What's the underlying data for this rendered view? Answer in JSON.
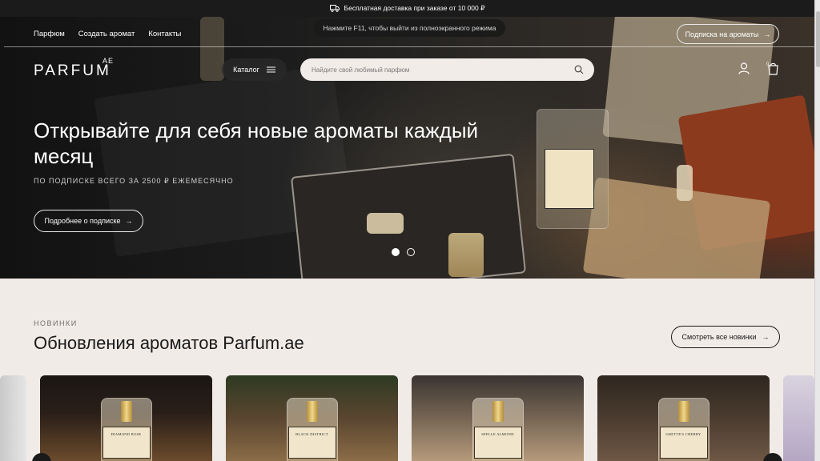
{
  "topbar": {
    "text": "Бесплатная доставка при заказе от 10 000 ₽",
    "icon": "truck-icon"
  },
  "fullscreen_notice": "Нажмите F11, чтобы выйти из полноэкранного режима",
  "nav": {
    "links": [
      "Парфюм",
      "Создать аромат",
      "Контакты"
    ],
    "subscription_button": "Подписка на ароматы",
    "arrow": "→"
  },
  "logo": {
    "text": "PARFUM",
    "suffix": "AE"
  },
  "catalog_label": "Каталог",
  "search": {
    "placeholder": "Найдите свой любимый парфюм"
  },
  "cart": {
    "count": "0"
  },
  "hero": {
    "title": "Открывайте для себя новые ароматы каждый месяц",
    "subtitle": "ПО ПОДПИСКЕ ВСЕГО ЗА 2500 ₽ ЕЖЕМЕСЯЧНО",
    "button": "Подробнее о подписке",
    "slides_total": 2,
    "active_slide": 1
  },
  "new_section": {
    "label": "НОВИНКИ",
    "title": "Обновления ароматов Parfum.ae",
    "button": "Смотреть все новинки"
  },
  "products": [
    {
      "label": "DIAMOND ROSE"
    },
    {
      "label": "BLACK DISTRICT"
    },
    {
      "label": "SPELLE ALMOND"
    },
    {
      "label": "GRETTE'S CHERRY"
    }
  ],
  "colors": {
    "dark": "#1b1b1b",
    "cream": "#f1ebe7",
    "accent_gold": "#c9a24a"
  }
}
